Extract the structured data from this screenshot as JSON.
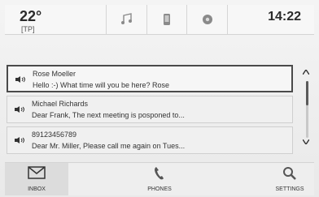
{
  "header": {
    "temperature": "22°",
    "tp_label": "[TP]",
    "time": "14:22",
    "status_icons": [
      "music-icon",
      "phone-icon",
      "settings-icon"
    ]
  },
  "messages": [
    {
      "sender": "Rose Moeller",
      "preview": "Hello :-) What time will you be here? Rose",
      "selected": true
    },
    {
      "sender": "Michael Richards",
      "preview": "Dear Frank, The next meeting is posponed to...",
      "selected": false
    },
    {
      "sender": "89123456789",
      "preview": "Dear Mr. Miller, Please call me again on Tues...",
      "selected": false
    }
  ],
  "bottom_nav": {
    "inbox": "INBOX",
    "phones": "PHONES",
    "settings": "SETTINGS"
  }
}
